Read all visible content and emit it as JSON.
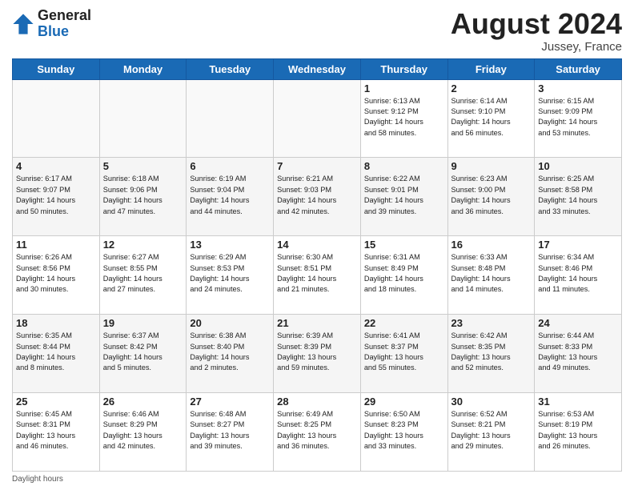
{
  "header": {
    "logo_general": "General",
    "logo_blue": "Blue",
    "month_year": "August 2024",
    "location": "Jussey, France"
  },
  "days_of_week": [
    "Sunday",
    "Monday",
    "Tuesday",
    "Wednesday",
    "Thursday",
    "Friday",
    "Saturday"
  ],
  "footer": {
    "daylight_label": "Daylight hours"
  },
  "weeks": [
    {
      "days": [
        {
          "date": "",
          "info": ""
        },
        {
          "date": "",
          "info": ""
        },
        {
          "date": "",
          "info": ""
        },
        {
          "date": "",
          "info": ""
        },
        {
          "date": "1",
          "info": "Sunrise: 6:13 AM\nSunset: 9:12 PM\nDaylight: 14 hours\nand 58 minutes."
        },
        {
          "date": "2",
          "info": "Sunrise: 6:14 AM\nSunset: 9:10 PM\nDaylight: 14 hours\nand 56 minutes."
        },
        {
          "date": "3",
          "info": "Sunrise: 6:15 AM\nSunset: 9:09 PM\nDaylight: 14 hours\nand 53 minutes."
        }
      ]
    },
    {
      "days": [
        {
          "date": "4",
          "info": "Sunrise: 6:17 AM\nSunset: 9:07 PM\nDaylight: 14 hours\nand 50 minutes."
        },
        {
          "date": "5",
          "info": "Sunrise: 6:18 AM\nSunset: 9:06 PM\nDaylight: 14 hours\nand 47 minutes."
        },
        {
          "date": "6",
          "info": "Sunrise: 6:19 AM\nSunset: 9:04 PM\nDaylight: 14 hours\nand 44 minutes."
        },
        {
          "date": "7",
          "info": "Sunrise: 6:21 AM\nSunset: 9:03 PM\nDaylight: 14 hours\nand 42 minutes."
        },
        {
          "date": "8",
          "info": "Sunrise: 6:22 AM\nSunset: 9:01 PM\nDaylight: 14 hours\nand 39 minutes."
        },
        {
          "date": "9",
          "info": "Sunrise: 6:23 AM\nSunset: 9:00 PM\nDaylight: 14 hours\nand 36 minutes."
        },
        {
          "date": "10",
          "info": "Sunrise: 6:25 AM\nSunset: 8:58 PM\nDaylight: 14 hours\nand 33 minutes."
        }
      ]
    },
    {
      "days": [
        {
          "date": "11",
          "info": "Sunrise: 6:26 AM\nSunset: 8:56 PM\nDaylight: 14 hours\nand 30 minutes."
        },
        {
          "date": "12",
          "info": "Sunrise: 6:27 AM\nSunset: 8:55 PM\nDaylight: 14 hours\nand 27 minutes."
        },
        {
          "date": "13",
          "info": "Sunrise: 6:29 AM\nSunset: 8:53 PM\nDaylight: 14 hours\nand 24 minutes."
        },
        {
          "date": "14",
          "info": "Sunrise: 6:30 AM\nSunset: 8:51 PM\nDaylight: 14 hours\nand 21 minutes."
        },
        {
          "date": "15",
          "info": "Sunrise: 6:31 AM\nSunset: 8:49 PM\nDaylight: 14 hours\nand 18 minutes."
        },
        {
          "date": "16",
          "info": "Sunrise: 6:33 AM\nSunset: 8:48 PM\nDaylight: 14 hours\nand 14 minutes."
        },
        {
          "date": "17",
          "info": "Sunrise: 6:34 AM\nSunset: 8:46 PM\nDaylight: 14 hours\nand 11 minutes."
        }
      ]
    },
    {
      "days": [
        {
          "date": "18",
          "info": "Sunrise: 6:35 AM\nSunset: 8:44 PM\nDaylight: 14 hours\nand 8 minutes."
        },
        {
          "date": "19",
          "info": "Sunrise: 6:37 AM\nSunset: 8:42 PM\nDaylight: 14 hours\nand 5 minutes."
        },
        {
          "date": "20",
          "info": "Sunrise: 6:38 AM\nSunset: 8:40 PM\nDaylight: 14 hours\nand 2 minutes."
        },
        {
          "date": "21",
          "info": "Sunrise: 6:39 AM\nSunset: 8:39 PM\nDaylight: 13 hours\nand 59 minutes."
        },
        {
          "date": "22",
          "info": "Sunrise: 6:41 AM\nSunset: 8:37 PM\nDaylight: 13 hours\nand 55 minutes."
        },
        {
          "date": "23",
          "info": "Sunrise: 6:42 AM\nSunset: 8:35 PM\nDaylight: 13 hours\nand 52 minutes."
        },
        {
          "date": "24",
          "info": "Sunrise: 6:44 AM\nSunset: 8:33 PM\nDaylight: 13 hours\nand 49 minutes."
        }
      ]
    },
    {
      "days": [
        {
          "date": "25",
          "info": "Sunrise: 6:45 AM\nSunset: 8:31 PM\nDaylight: 13 hours\nand 46 minutes."
        },
        {
          "date": "26",
          "info": "Sunrise: 6:46 AM\nSunset: 8:29 PM\nDaylight: 13 hours\nand 42 minutes."
        },
        {
          "date": "27",
          "info": "Sunrise: 6:48 AM\nSunset: 8:27 PM\nDaylight: 13 hours\nand 39 minutes."
        },
        {
          "date": "28",
          "info": "Sunrise: 6:49 AM\nSunset: 8:25 PM\nDaylight: 13 hours\nand 36 minutes."
        },
        {
          "date": "29",
          "info": "Sunrise: 6:50 AM\nSunset: 8:23 PM\nDaylight: 13 hours\nand 33 minutes."
        },
        {
          "date": "30",
          "info": "Sunrise: 6:52 AM\nSunset: 8:21 PM\nDaylight: 13 hours\nand 29 minutes."
        },
        {
          "date": "31",
          "info": "Sunrise: 6:53 AM\nSunset: 8:19 PM\nDaylight: 13 hours\nand 26 minutes."
        }
      ]
    }
  ]
}
